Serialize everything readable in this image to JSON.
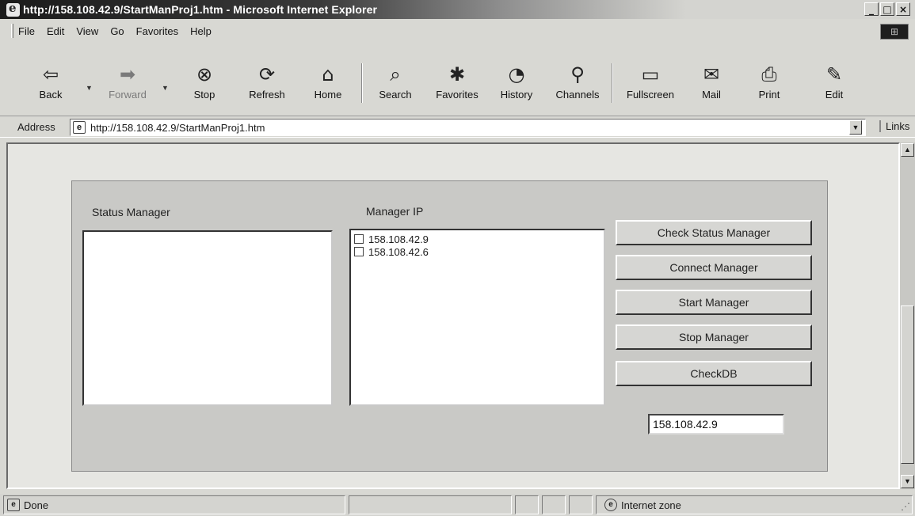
{
  "window": {
    "title": "http://158.108.42.9/StartManProj1.htm - Microsoft Internet Explorer",
    "controls": {
      "minimize": "_",
      "maximize": "□",
      "close": "×"
    }
  },
  "menu": [
    "File",
    "Edit",
    "View",
    "Go",
    "Favorites",
    "Help"
  ],
  "toolbar": {
    "buttons": [
      {
        "label": "Back",
        "icon": "back-arrow-icon",
        "glyph": "⇦",
        "enabled": true
      },
      {
        "label": "Forward",
        "icon": "forward-arrow-icon",
        "glyph": "➡",
        "enabled": false
      },
      {
        "label": "Stop",
        "icon": "stop-icon",
        "glyph": "⊗",
        "enabled": true
      },
      {
        "label": "Refresh",
        "icon": "refresh-icon",
        "glyph": "⟳",
        "enabled": true
      },
      {
        "label": "Home",
        "icon": "home-icon",
        "glyph": "⌂",
        "enabled": true
      },
      {
        "label": "Search",
        "icon": "search-icon",
        "glyph": "⌕",
        "enabled": true
      },
      {
        "label": "Favorites",
        "icon": "favorites-icon",
        "glyph": "✱",
        "enabled": true
      },
      {
        "label": "History",
        "icon": "history-icon",
        "glyph": "◔",
        "enabled": true
      },
      {
        "label": "Channels",
        "icon": "channels-icon",
        "glyph": "⚲",
        "enabled": true
      },
      {
        "label": "Fullscreen",
        "icon": "fullscreen-icon",
        "glyph": "▭",
        "enabled": true
      },
      {
        "label": "Mail",
        "icon": "mail-icon",
        "glyph": "✉",
        "enabled": true
      },
      {
        "label": "Print",
        "icon": "print-icon",
        "glyph": "⎙",
        "enabled": true
      },
      {
        "label": "Edit",
        "icon": "edit-icon",
        "glyph": "✎",
        "enabled": true
      }
    ]
  },
  "address": {
    "label": "Address",
    "url": "http://158.108.42.9/StartManProj1.htm",
    "links_label": "Links"
  },
  "page": {
    "status_manager_label": "Status Manager",
    "manager_ip_label": "Manager IP",
    "manager_ips": [
      "158.108.42.9",
      "158.108.42.6"
    ],
    "buttons": {
      "check_status": "Check Status Manager",
      "connect": "Connect Manager",
      "start": "Start Manager",
      "stop": "Stop Manager",
      "checkdb": "CheckDB"
    },
    "ip_value": "158.108.42.9"
  },
  "status": {
    "text": "Done",
    "zone": "Internet zone"
  }
}
